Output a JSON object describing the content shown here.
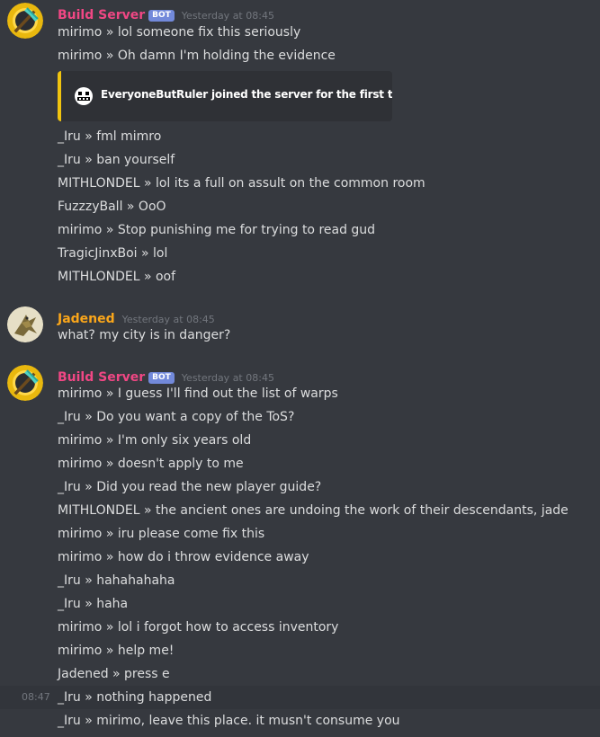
{
  "groups": [
    {
      "author": "Build Server",
      "author_color": "#f04784",
      "badge": "BOT",
      "timestamp": "Yesterday at 08:45",
      "avatar_icon": "pickaxe-icon",
      "lines": [
        "mirimo »  lol someone fix this seriously",
        "mirimo »  Oh damn I'm holding the evidence"
      ],
      "embed": {
        "icon": "smiley-face-icon",
        "accent": "#f1c40f",
        "text": "EveryoneButRuler joined the server for the first time"
      },
      "lines_after": [
        "_Iru »  fml mimro",
        "_Iru »  ban yourself",
        "MITHLONDEL »  lol its a full on assult on the common room",
        "FuzzzyBall »  OoO",
        "mirimo »  Stop punishing me for trying to read gud",
        "TragicJinxBoi »  lol",
        "MITHLONDEL »  oof"
      ]
    },
    {
      "author": "Jadened",
      "author_color": "#faa61a",
      "timestamp": "Yesterday at 08:45",
      "avatar_icon": "bird-avatar-icon",
      "lines": [
        "what? my city is in danger?"
      ]
    },
    {
      "author": "Build Server",
      "author_color": "#f04784",
      "badge": "BOT",
      "timestamp": "Yesterday at 08:45",
      "avatar_icon": "pickaxe-icon",
      "hover_time": "08:47",
      "lines": [
        "mirimo »  I guess I'll find out the list of warps",
        "_Iru »  Do you want a copy of the ToS?",
        "mirimo »  I'm only six years old",
        "mirimo »  doesn't apply to me",
        "_Iru »  Did you read the new player guide?",
        "MITHLONDEL »  the ancient ones are undoing the work of their descendants, jade",
        "mirimo »  iru please come fix this",
        "mirimo »  how do i throw evidence away",
        "_Iru »  hahahahaha",
        "_Iru »  haha",
        "mirimo »  lol i forgot how to access inventory",
        "mirimo »  help me!",
        "Jadened »  press e",
        "_Iru »  nothing happened",
        "_Iru »  mirimo, leave this place. it musn't consume you"
      ]
    }
  ]
}
